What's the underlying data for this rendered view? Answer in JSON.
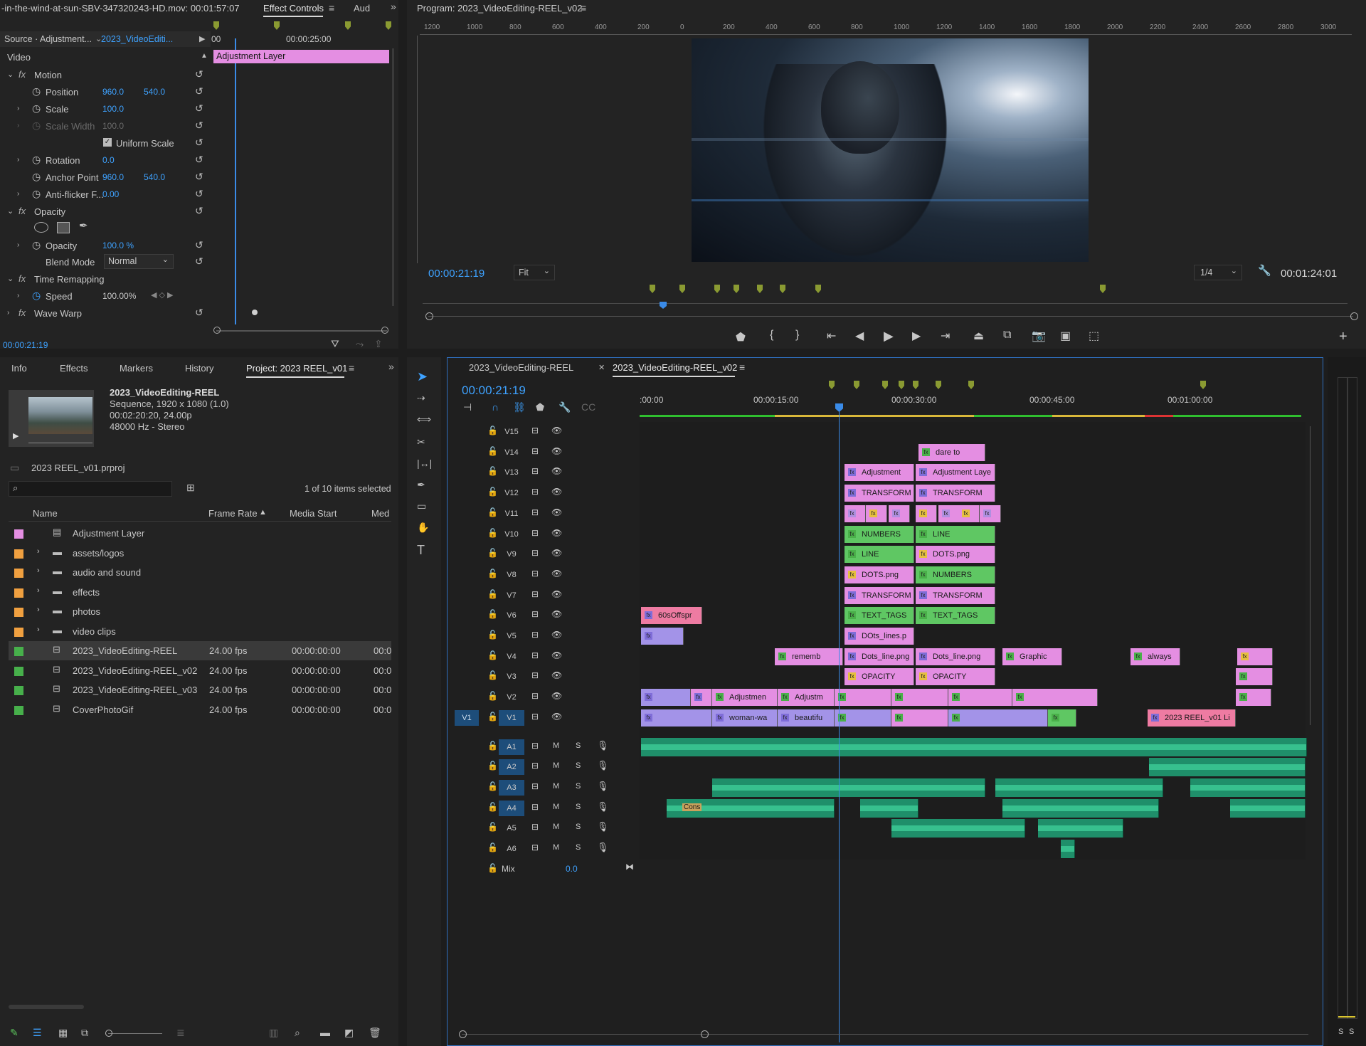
{
  "source_panel": {
    "clip_name": "-in-the-wind-at-sun-SBV-347320243-HD.mov: 00:01:57:07",
    "tabs": [
      "Effect Controls",
      "Aud"
    ],
    "source_label": "Source · Adjustment...",
    "sequence_label": "2023_VideoEditi...",
    "time_ruler": [
      "00",
      "00:00:25:00"
    ],
    "clip_bar_label": "Adjustment Layer",
    "section_video": "Video",
    "properties": [
      {
        "fx": "Motion"
      },
      {
        "name": "Position",
        "v1": "960.0",
        "v2": "540.0"
      },
      {
        "name": "Scale",
        "v1": "100.0"
      },
      {
        "name": "Scale Width",
        "v1": "100.0"
      },
      {
        "name": "Uniform Scale"
      },
      {
        "name": "Rotation",
        "v1": "0.0"
      },
      {
        "name": "Anchor Point",
        "v1": "960.0",
        "v2": "540.0"
      },
      {
        "name": "Anti-flicker F...",
        "v1": "0.00"
      },
      {
        "fx": "Opacity"
      },
      {
        "name": "Opacity",
        "v1": "100.0 %"
      },
      {
        "name": "Blend Mode",
        "select": "Normal"
      },
      {
        "fx": "Time Remapping"
      },
      {
        "name": "Speed",
        "v1": "100.00%"
      },
      {
        "fx": "Wave Warp"
      }
    ],
    "timecode": "00:00:21:19"
  },
  "program_monitor": {
    "title": "Program: 2023_VideoEditing-REEL_v02",
    "ruler_labels": [
      "1200",
      "1000",
      "800",
      "600",
      "400",
      "200",
      "0",
      "200",
      "400",
      "600",
      "800",
      "1000",
      "1200",
      "1400",
      "1600",
      "1800",
      "2000",
      "2200",
      "2400",
      "2600",
      "2800",
      "3000"
    ],
    "timecode": "00:00:21:19",
    "fit": "Fit",
    "resolution": "1/4",
    "duration": "00:01:24:01"
  },
  "project_panel": {
    "tabs": [
      "Info",
      "Effects",
      "Markers",
      "History",
      "Project: 2023 REEL_v01"
    ],
    "sequence_name": "2023_VideoEditing-REEL",
    "sequence_info": [
      "Sequence, 1920 x 1080 (1.0)",
      "00:02:20:20, 24.00p",
      "48000 Hz - Stereo"
    ],
    "project_file": "2023 REEL_v01.prproj",
    "search_placeholder": "",
    "selection_count": "1 of 10 items selected",
    "columns": [
      "Name",
      "Frame Rate",
      "Media Start",
      "Med"
    ],
    "items": [
      {
        "name": "Adjustment Layer",
        "color": "#e48ee2",
        "type": "layer"
      },
      {
        "name": "assets/logos",
        "color": "#f0a040",
        "type": "folder"
      },
      {
        "name": "audio and sound",
        "color": "#f0a040",
        "type": "folder"
      },
      {
        "name": "effects",
        "color": "#f0a040",
        "type": "folder"
      },
      {
        "name": "photos",
        "color": "#f0a040",
        "type": "folder"
      },
      {
        "name": "video clips",
        "color": "#f0a040",
        "type": "folder"
      },
      {
        "name": "2023_VideoEditing-REEL",
        "color": "#47b04b",
        "type": "sequence",
        "fps": "24.00 fps",
        "start": "00:00:00:00",
        "med": "00:0",
        "selected": true
      },
      {
        "name": "2023_VideoEditing-REEL_v02",
        "color": "#47b04b",
        "type": "sequence",
        "fps": "24.00 fps",
        "start": "00:00:00:00",
        "med": "00:0"
      },
      {
        "name": "2023_VideoEditing-REEL_v03",
        "color": "#47b04b",
        "type": "sequence",
        "fps": "24.00 fps",
        "start": "00:00:00:00",
        "med": "00:0"
      },
      {
        "name": "CoverPhotoGif",
        "color": "#47b04b",
        "type": "sequence",
        "fps": "24.00 fps",
        "start": "00:00:00:00",
        "med": "00:0"
      }
    ]
  },
  "timeline": {
    "tabs": [
      "2023_VideoEditing-REEL",
      "2023_VideoEditing-REEL_v02"
    ],
    "timecode": "00:00:21:19",
    "ruler": [
      ":00:00",
      "00:00:15:00",
      "00:00:30:00",
      "00:00:45:00",
      "00:01:00:00"
    ],
    "video_tracks": [
      "V15",
      "V14",
      "V13",
      "V12",
      "V11",
      "V10",
      "V9",
      "V8",
      "V7",
      "V6",
      "V5",
      "V4",
      "V3",
      "V2",
      "V1"
    ],
    "audio_tracks": [
      "A1",
      "A2",
      "A3",
      "A4",
      "A5",
      "A6"
    ],
    "source_patch": "V1",
    "mix_label": "Mix",
    "mix_value": "0.0",
    "clips": {
      "v14": "dare to",
      "v13a": "Adjustment",
      "v13b": "Adjustment Laye",
      "v12a": "TRANSFORM",
      "v12b": "TRANSFORM",
      "v10a": "NUMBERS",
      "v10b": "LINE",
      "v9a": "LINE",
      "v9b": "DOTS.png",
      "v8a": "DOTS.png",
      "v8b": "NUMBERS",
      "v7a": "TRANSFORM",
      "v7b": "TRANSFORM",
      "v6a": "60sOffspr",
      "v6b": "TEXT_TAGS",
      "v6c": "TEXT_TAGS",
      "v5a": "DOts_lines.p",
      "v4a": "rememb",
      "v4b": "Dots_line.png",
      "v4c": "Dots_line.png",
      "v4d": "Graphic",
      "v4e": "always",
      "v3a": "OPACITY",
      "v3b": "OPACITY",
      "v2a": "Adjustmen",
      "v2b": "Adjustm",
      "v1a": "woman-wa",
      "v1b": "beautifu",
      "v1c": "2023 REEL_v01 Li",
      "a4a": "Cons"
    }
  }
}
